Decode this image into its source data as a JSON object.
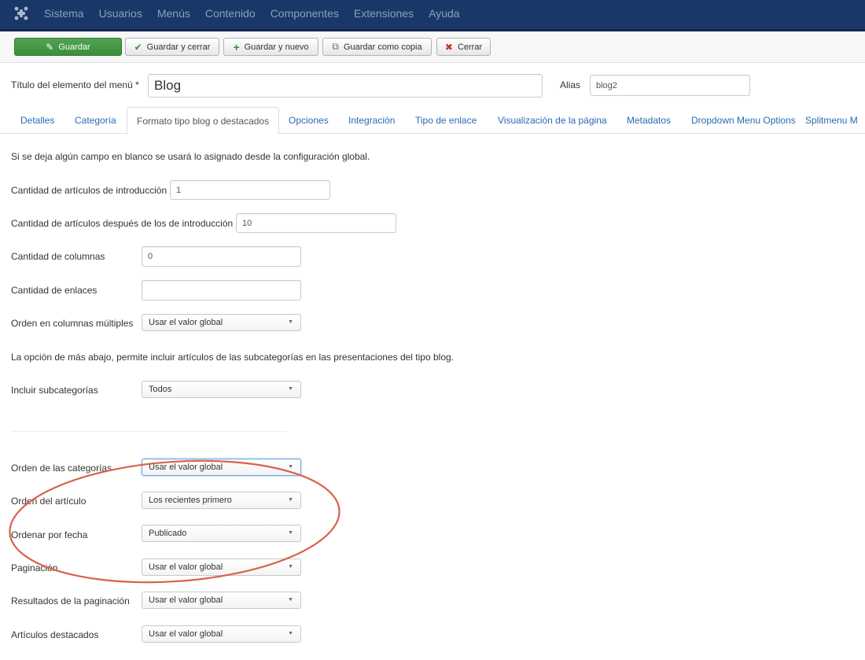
{
  "navbar": {
    "menu": [
      "Sistema",
      "Usuarios",
      "Menús",
      "Contenido",
      "Componentes",
      "Extensiones",
      "Ayuda"
    ]
  },
  "toolbar": {
    "save": "Guardar",
    "save_close": "Guardar y cerrar",
    "save_new": "Guardar y nuevo",
    "save_copy": "Guardar como copia",
    "close": "Cerrar"
  },
  "title_row": {
    "title_label": "Título del elemento del menú *",
    "title_value": "Blog",
    "alias_label": "Alias",
    "alias_value": "blog2"
  },
  "tabs": [
    "Detalles",
    "Categoría",
    "Formato tipo blog o destacados",
    "Opciones",
    "Integración",
    "Tipo de enlace",
    "Visualización de la página",
    "Metadatos",
    "Dropdown Menu Options",
    "Splitmenu M"
  ],
  "form": {
    "intro_note": "Si se deja algún campo en blanco se usará lo asignado desde la configuración global.",
    "num_intro_label": "Cantidad de artículos de introducción",
    "num_intro_value": "1",
    "num_leading_label": "Cantidad de artículos después de los de introducción",
    "num_leading_value": "10",
    "num_columns_label": "Cantidad de columnas",
    "num_columns_value": "0",
    "num_links_label": "Cantidad de enlaces",
    "num_links_value": "",
    "multi_column_order_label": "Orden en columnas múltiples",
    "multi_column_order_value": "Usar el valor global",
    "subcat_note": "La opción de más abajo, permite incluir artículos de las subcategorías en las presentaciones del tipo blog.",
    "include_subcats_label": "Incluir subcategorías",
    "include_subcats_value": "Todos",
    "category_order_label": "Orden de las categorías",
    "category_order_value": "Usar el valor global",
    "article_order_label": "Orden del artículo",
    "article_order_value": "Los recientes primero",
    "date_order_label": "Ordenar por fecha",
    "date_order_value": "Publicado",
    "pagination_label": "Paginación",
    "pagination_value": "Usar el valor global",
    "pagination_results_label": "Resultados de la paginación",
    "pagination_results_value": "Usar el valor global",
    "featured_label": "Artículos destacados",
    "featured_value": "Usar el valor global"
  },
  "colors": {
    "navbar": "#1a3867",
    "link": "#2a69b8",
    "success": "#46a046",
    "annotation": "#d9614c"
  }
}
